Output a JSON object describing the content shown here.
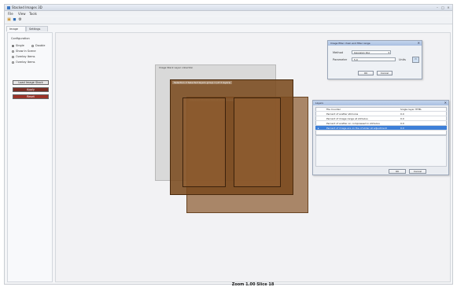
{
  "window": {
    "title": "Stacked Images 3D",
    "controls": [
      "–",
      "□",
      "✕"
    ]
  },
  "menu": [
    "File",
    "View",
    "Tools"
  ],
  "toolbar": {
    "icons": [
      "open-icon",
      "save-icon",
      "settings-icon"
    ]
  },
  "tabs": [
    "Image Stack",
    "Settings Panel"
  ],
  "left_panel": {
    "group_title": "Configuration",
    "radios": [
      {
        "label": "Single",
        "selected": true
      },
      {
        "label": "Double",
        "selected": false
      },
      {
        "label": "Show in Scene",
        "selected": false
      },
      {
        "label": "Overlay Items",
        "selected": false
      },
      {
        "label": "Overlay Items",
        "selected": false
      }
    ],
    "buttons": [
      {
        "label": "Load Image Stack",
        "bg": "#e6e6e6",
        "color": "#222222"
      },
      {
        "label": "Apply",
        "bg": "#7a2e24",
        "color": "#ffffff"
      },
      {
        "label": "Reset",
        "bg": "#9c3328",
        "color": "#ffffff"
      }
    ]
  },
  "canvas": {
    "layers": [
      {
        "label": "Image Stack Layer collection"
      },
      {
        "label": "Selection 2 Selected layers group 1 (of 3 layers)"
      },
      {
        "label": "Layered Shadow Slot (2 of 3 images)"
      }
    ],
    "status": "Zoom 1.00 Slice 18"
  },
  "colors": {
    "layer_gray": "#d9d9d9",
    "layer_dark_brown": "#7a4a1e",
    "layer_light_brown": "#9b6a3e",
    "selection_blue": "#3d7fd8"
  },
  "dialog_top": {
    "title": "Image filter chain and filter range",
    "close": "✕",
    "method_label": "Method",
    "method_value": "Gaussian blur",
    "parameter_label": "Parameter",
    "parameter_value": "5.0",
    "unit_label": "Units",
    "ok": "OK",
    "cancel": "Cancel"
  },
  "dialog_props": {
    "title": "Layers",
    "close": "✕",
    "rows": [
      {
        "mark": "",
        "name": "File Counter",
        "value": "Single layer HTML"
      },
      {
        "mark": "",
        "name": "Percent of scatter stimulus",
        "value": "0.0"
      },
      {
        "mark": "",
        "name": "Percent of image range at stimulus",
        "value": "0.0"
      },
      {
        "mark": "",
        "name": "Percent of scatter on compressed in stimulus",
        "value": "0.0"
      },
      {
        "mark": "▸",
        "name": "Percent of image are on the of slider at adjustment",
        "value": "0.0"
      }
    ],
    "selected_row": 4,
    "ok": "OK",
    "cancel": "Cancel"
  }
}
